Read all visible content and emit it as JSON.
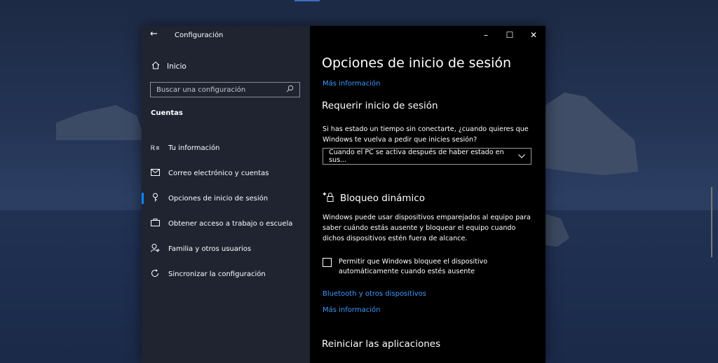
{
  "window": {
    "title": "Configuración"
  },
  "sidebar": {
    "home_label": "Inicio",
    "search_placeholder": "Buscar una configuración",
    "section_title": "Cuentas",
    "items": [
      {
        "label": "Tu información",
        "icon": "person-card-icon"
      },
      {
        "label": "Correo electrónico y cuentas",
        "icon": "mail-icon"
      },
      {
        "label": "Opciones de inicio de sesión",
        "icon": "key-icon",
        "active": true
      },
      {
        "label": "Obtener acceso a trabajo o escuela",
        "icon": "briefcase-icon"
      },
      {
        "label": "Familia y otros usuarios",
        "icon": "person-add-icon"
      },
      {
        "label": "Sincronizar la configuración",
        "icon": "sync-icon"
      }
    ]
  },
  "content": {
    "page_title": "Opciones de inicio de sesión",
    "more_info_1": "Más información",
    "require_title": "Requerir inicio de sesión",
    "require_text": "Si has estado un tiempo sin conectarte, ¿cuando quieres que Windows te vuelva a pedir que inicies sesión?",
    "dropdown_value": "Cuando el PC se activa después de haber estado en sus...",
    "dynamic_title": "Bloqueo dinámico",
    "dynamic_text": "Windows puede usar dispositivos emparejados al equipo para saber cuándo estás ausente y bloquear el equipo cuando dichos dispositivos estén fuera de alcance.",
    "checkbox_label": "Permitir que Windows bloquee el dispositivo automáticamente cuando estés ausente",
    "checkbox_checked": false,
    "bluetooth_link": "Bluetooth y otros dispositivos",
    "more_info_2": "Más información",
    "restart_title": "Reiniciar las aplicaciones"
  },
  "colors": {
    "accent": "#0a84ff",
    "link": "#3a9bff",
    "sidebar_bg": "#1f2430"
  }
}
